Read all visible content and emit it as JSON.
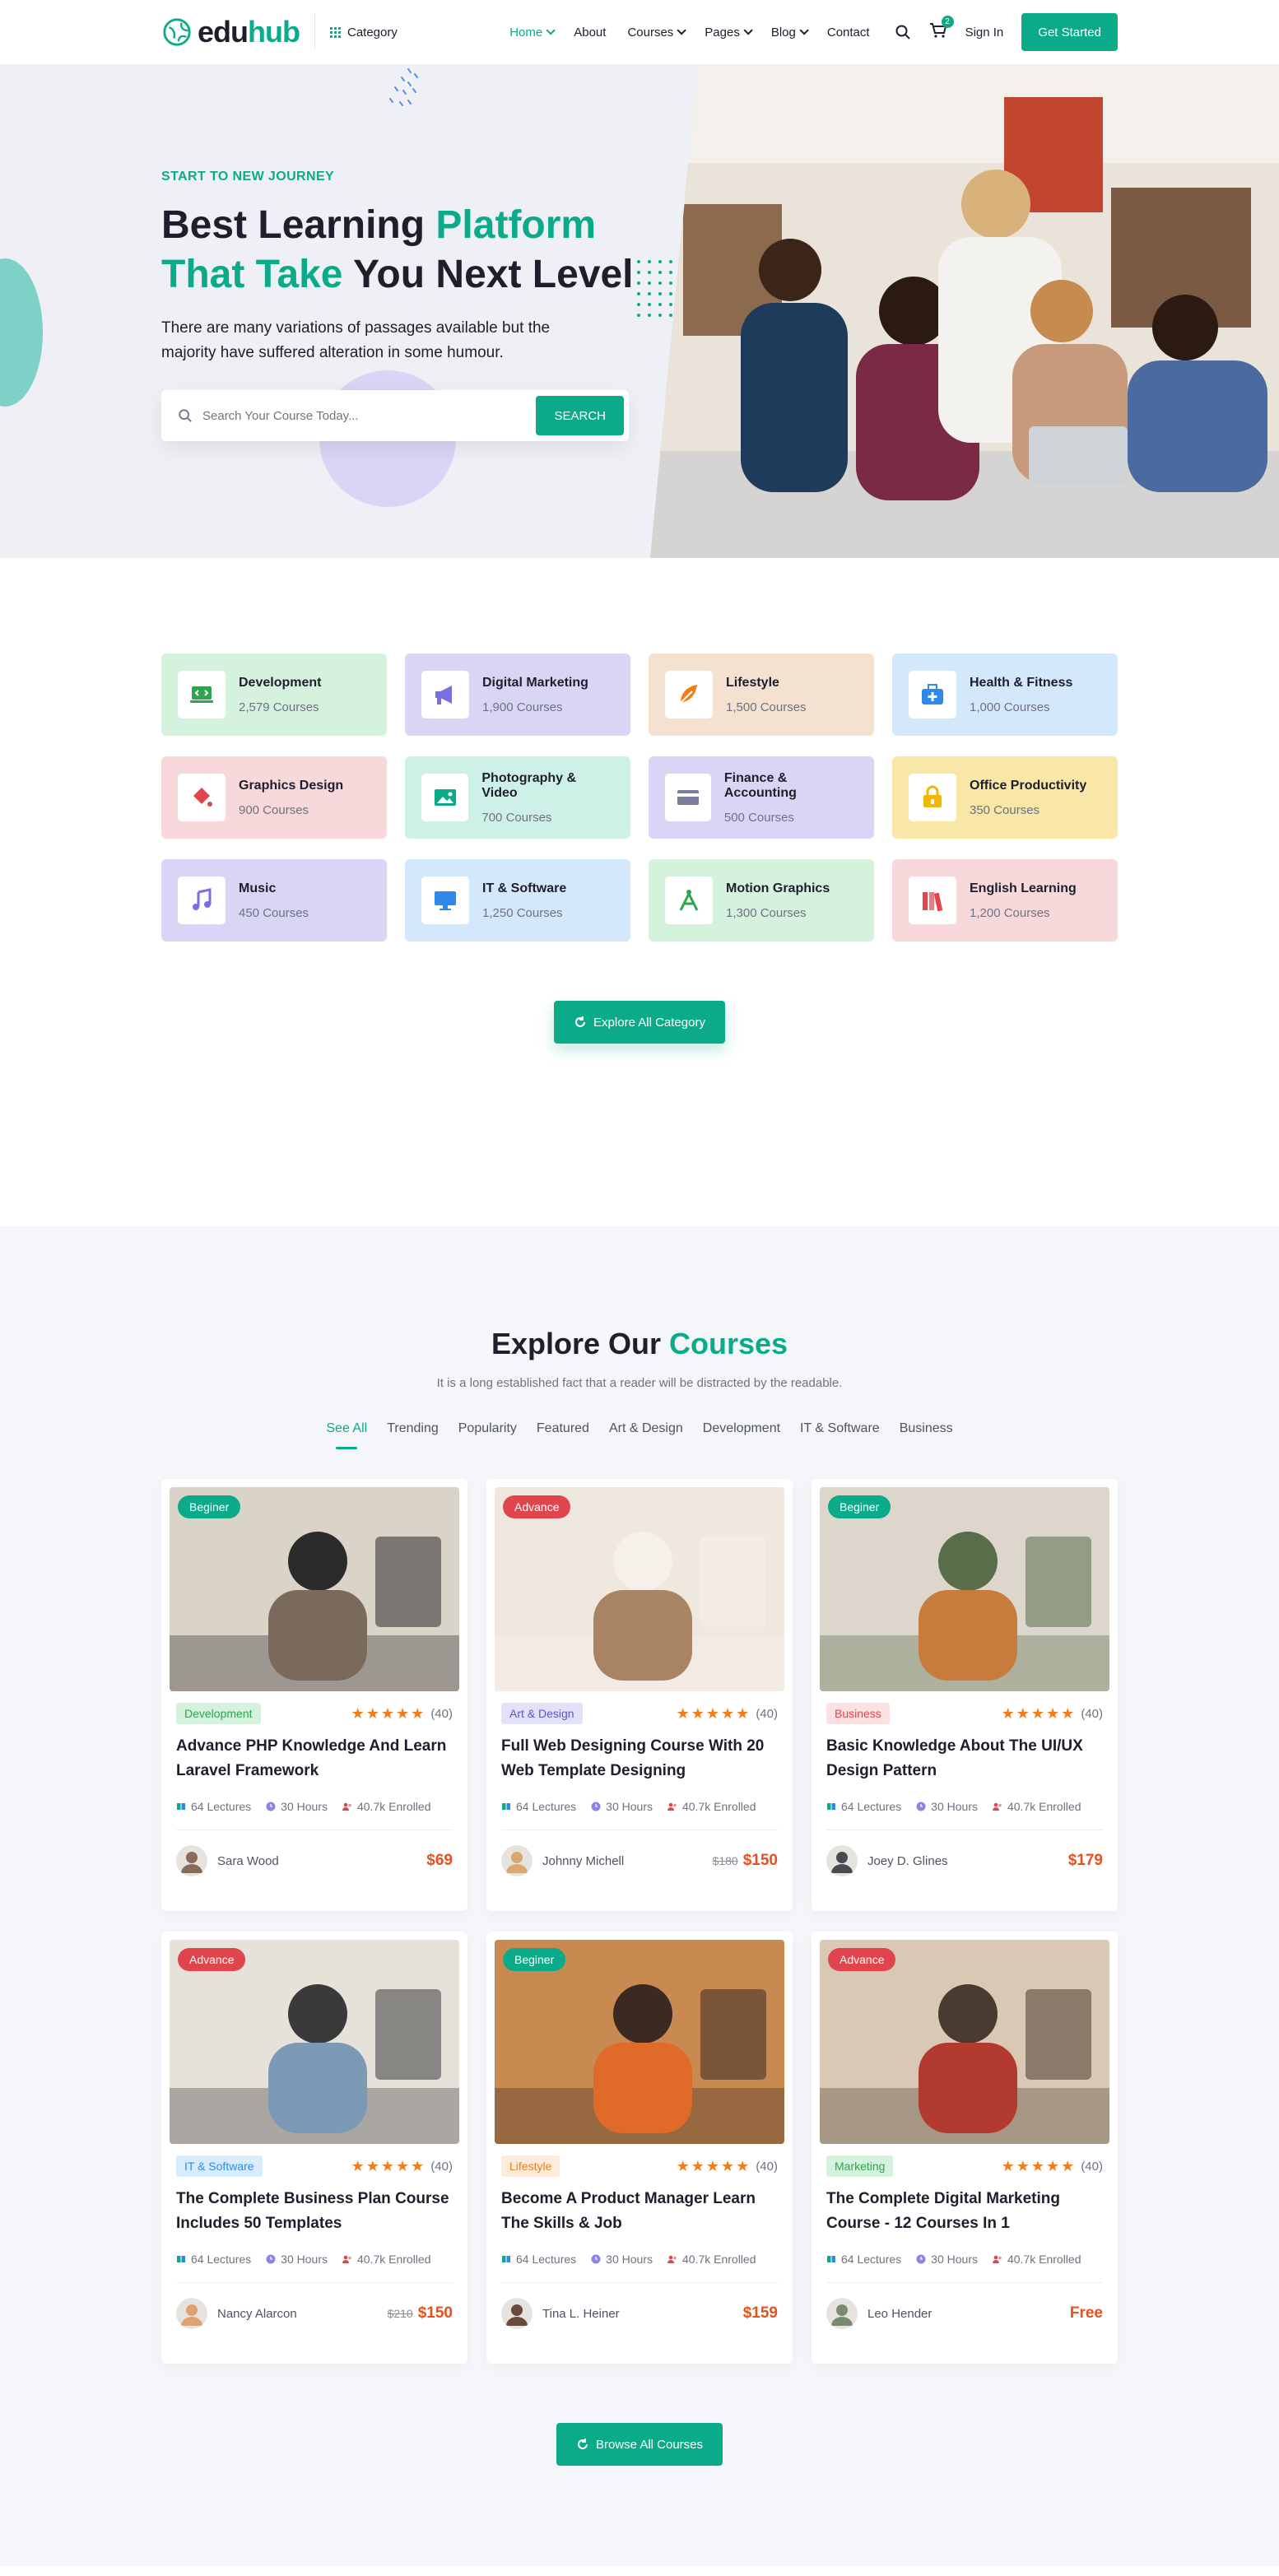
{
  "header": {
    "logo_edu": "edu",
    "logo_hub": "hub",
    "category_label": "Category",
    "nav": [
      {
        "label": "Home",
        "dropdown": true,
        "active": true
      },
      {
        "label": "About",
        "dropdown": false
      },
      {
        "label": "Courses",
        "dropdown": true
      },
      {
        "label": "Pages",
        "dropdown": true
      },
      {
        "label": "Blog",
        "dropdown": true
      },
      {
        "label": "Contact",
        "dropdown": false
      }
    ],
    "cart_count": "2",
    "signin_label": "Sign In",
    "cta_label": "Get Started"
  },
  "hero": {
    "kicker": "START TO NEW JOURNEY",
    "title_a": "Best Learning ",
    "title_b": "Platform",
    "title_c": "That Take",
    "title_d": " You Next Level",
    "description": "There are many variations of passages available but the majority have suffered alteration in some humour.",
    "search_placeholder": "Search Your Course Today...",
    "search_button": "SEARCH"
  },
  "categories": {
    "items": [
      {
        "name": "Development",
        "count": "2,579 Courses",
        "bg": "#d5f2df",
        "icon": "laptop-code-icon",
        "color": "#2ea44f"
      },
      {
        "name": "Digital Marketing",
        "count": "1,900 Courses",
        "bg": "#d8d6f4",
        "icon": "megaphone-icon",
        "color": "#7a6fe0"
      },
      {
        "name": "Lifestyle",
        "count": "1,500 Courses",
        "bg": "#f4e1d0",
        "icon": "feather-icon",
        "color": "#f07d1a"
      },
      {
        "name": "Health & Fitness",
        "count": "1,000 Courses",
        "bg": "#d3e8fb",
        "icon": "medical-kit-icon",
        "color": "#2e8ae6"
      },
      {
        "name": "Graphics Design",
        "count": "900 Courses",
        "bg": "#f7d9db",
        "icon": "paint-bucket-icon",
        "color": "#e0454e"
      },
      {
        "name": "Photography & Video",
        "count": "700 Courses",
        "bg": "#cdf1e7",
        "icon": "image-icon",
        "color": "#0bab8a"
      },
      {
        "name": "Finance & Accounting",
        "count": "500 Courses",
        "bg": "#d8d6f4",
        "icon": "credit-card-icon",
        "color": "#7a7d99"
      },
      {
        "name": "Office Productivity",
        "count": "350 Courses",
        "bg": "#f8e7a6",
        "icon": "office-lock-icon",
        "color": "#f2b705"
      },
      {
        "name": "Music",
        "count": "450 Courses",
        "bg": "#d8d6f4",
        "icon": "music-note-icon",
        "color": "#7a6fe0"
      },
      {
        "name": "IT & Software",
        "count": "1,250 Courses",
        "bg": "#d3e8fb",
        "icon": "monitor-icon",
        "color": "#2e8ae6"
      },
      {
        "name": "Motion Graphics",
        "count": "1,300 Courses",
        "bg": "#d5f2df",
        "icon": "compass-pen-icon",
        "color": "#2ea44f"
      },
      {
        "name": "English Learning",
        "count": "1,200 Courses",
        "bg": "#f7d9db",
        "icon": "books-icon",
        "color": "#e0454e"
      }
    ],
    "explore_label": "Explore All Category"
  },
  "courses": {
    "title_a": "Explore Our ",
    "title_b": "Courses",
    "subtitle": "It is a long established fact that a reader will be distracted by the readable.",
    "tabs": [
      "See All",
      "Trending",
      "Popularity",
      "Featured",
      "Art & Design",
      "Development",
      "IT & Software",
      "Business"
    ],
    "cards": [
      {
        "level": "Beginer",
        "level_color": "#0bab8a",
        "tag": "Development",
        "tag_bg": "#d5f2df",
        "tag_fg": "#2ea44f",
        "rating": "(40)",
        "title": "Advance PHP Knowledge And Learn Laravel Framework",
        "lectures": "64 Lectures",
        "hours": "30 Hours",
        "enrolled": "40.7k Enrolled",
        "author": "Sara Wood",
        "old_price": "",
        "price": "$69",
        "thumb": [
          "#d9d3c8",
          "#7a6a5c",
          "#2b2b2b"
        ]
      },
      {
        "level": "Advance",
        "level_color": "#e0454e",
        "tag": "Art & Design",
        "tag_bg": "#e3e1f8",
        "tag_fg": "#5e52c8",
        "rating": "(40)",
        "title": "Full Web Designing Course With 20 Web Template Designing",
        "lectures": "64 Lectures",
        "hours": "30 Hours",
        "enrolled": "40.7k Enrolled",
        "author": "Johnny Michell",
        "old_price": "$180",
        "price": "$150",
        "thumb": [
          "#efe8df",
          "#a88465",
          "#f5f0ea"
        ]
      },
      {
        "level": "Beginer",
        "level_color": "#0bab8a",
        "tag": "Business",
        "tag_bg": "#fbe1e2",
        "tag_fg": "#e0454e",
        "rating": "(40)",
        "title": "Basic Knowledge About The UI/UX Design Pattern",
        "lectures": "64 Lectures",
        "hours": "30 Hours",
        "enrolled": "40.7k Enrolled",
        "author": "Joey D. Glines",
        "old_price": "",
        "price": "$179",
        "thumb": [
          "#ddd6cc",
          "#c77b3c",
          "#5a6d4a"
        ]
      },
      {
        "level": "Advance",
        "level_color": "#e0454e",
        "tag": "IT & Software",
        "tag_bg": "#d9ecfb",
        "tag_fg": "#2e8ae6",
        "rating": "(40)",
        "title": "The Complete Business Plan Course Includes 50 Templates",
        "lectures": "64 Lectures",
        "hours": "30 Hours",
        "enrolled": "40.7k Enrolled",
        "author": "Nancy Alarcon",
        "old_price": "$210",
        "price": "$150",
        "thumb": [
          "#e6e2da",
          "#7c99b5",
          "#3a3a3a"
        ]
      },
      {
        "level": "Beginer",
        "level_color": "#0bab8a",
        "tag": "Lifestyle",
        "tag_bg": "#fdebdc",
        "tag_fg": "#f07d1a",
        "rating": "(40)",
        "title": "Become A Product Manager Learn The Skills & Job",
        "lectures": "64 Lectures",
        "hours": "30 Hours",
        "enrolled": "40.7k Enrolled",
        "author": "Tina L. Heiner",
        "old_price": "",
        "price": "$159",
        "thumb": [
          "#c98a52",
          "#e06a2a",
          "#3b2a22"
        ]
      },
      {
        "level": "Advance",
        "level_color": "#e0454e",
        "tag": "Marketing",
        "tag_bg": "#d5f2df",
        "tag_fg": "#2ea44f",
        "rating": "(40)",
        "title": "The Complete Digital Marketing Course - 12 Courses In 1",
        "lectures": "64 Lectures",
        "hours": "30 Hours",
        "enrolled": "40.7k Enrolled",
        "author": "Leo Hender",
        "old_price": "",
        "price": "Free",
        "thumb": [
          "#d9c9b4",
          "#b23a2e",
          "#4a3b30"
        ]
      }
    ],
    "browse_label": "Browse All Courses"
  }
}
